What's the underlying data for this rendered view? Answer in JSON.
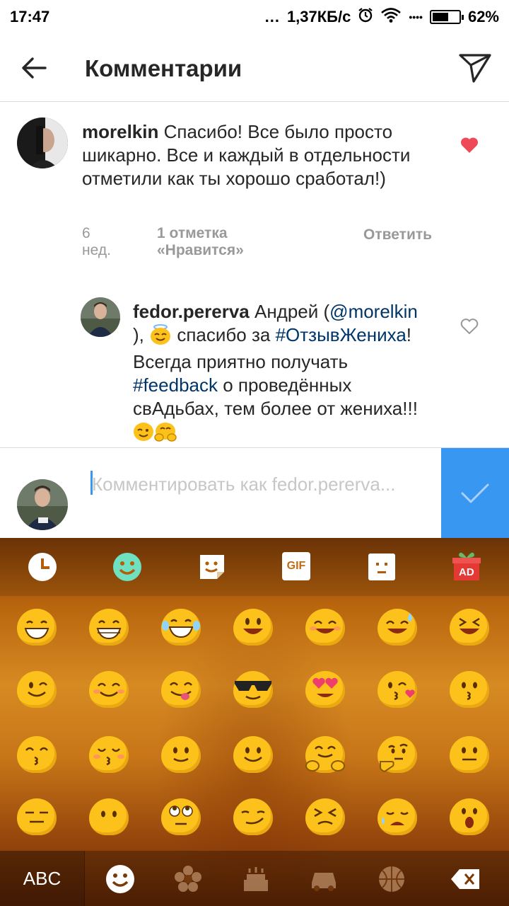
{
  "status_bar": {
    "time": "17:47",
    "dots": "...",
    "speed": "1,37КБ/с",
    "signal": "••••",
    "battery": "62%",
    "battery_level": 0.62
  },
  "header": {
    "title": "Комментарии",
    "back_icon": "arrow-left-icon",
    "send_icon": "paper-plane-icon"
  },
  "comments": [
    {
      "user": "morelkin",
      "text": " Спасибо! Все было просто шикарно. Все и каждый в отдельности отметили как ты хорошо сработал!)",
      "time": "6 нед.",
      "likes": "1 отметка «Нравится»",
      "reply": "Ответить",
      "liked": true
    },
    {
      "user": "fedor.pererva",
      "text_1": " Андрей (",
      "mention": "@morelkin",
      "text_2": " ), ",
      "text_3": " спасибо за ",
      "hashtag_1": "#ОтзывЖениха",
      "text_4": "! Всегда приятно получать ",
      "hashtag_2": "#feedback",
      "text_5": " о проведённых свАдьбах, тем более от жениха!!! ",
      "liked": false
    }
  ],
  "input": {
    "placeholder": "Комментировать как fedor.pererva...",
    "submit_icon": "checkmark-icon"
  },
  "keyboard": {
    "toolbar_icons": [
      "recent-icon",
      "emoji-icon",
      "sticker-icon",
      "gif-icon",
      "emoticon-icon",
      "ad-gift-icon"
    ],
    "gif_label": "GIF",
    "ad_label": "AD",
    "abc_label": "ABC",
    "categories": [
      "smiley-icon",
      "flower-icon",
      "cake-icon",
      "car-icon",
      "basketball-icon",
      "backspace-icon"
    ]
  },
  "colors": {
    "accent": "#3897f0",
    "heart": "#ed4956",
    "link": "#003569",
    "emoji_yellow": "#fcc21b"
  }
}
